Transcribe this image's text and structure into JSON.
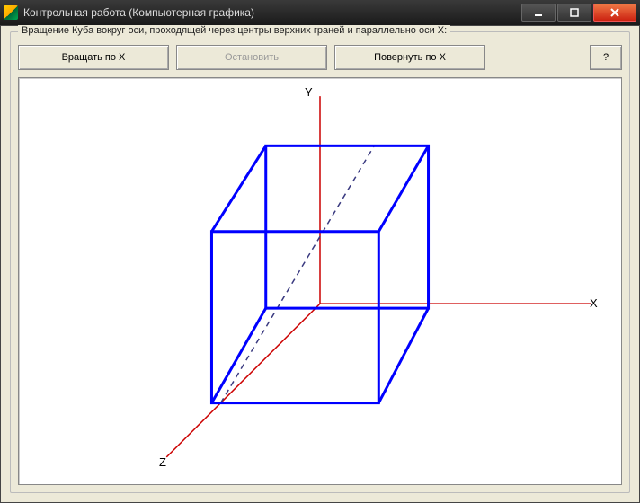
{
  "window": {
    "title": "Контрольная работа (Компьютерная графика)"
  },
  "group": {
    "legend": "Вращение Куба вокруг оси, проходящей через центры верхних граней и параллельно оси X:"
  },
  "buttons": {
    "rotate": "Вращать по X",
    "stop": "Остановить",
    "turn": "Повернуть по X",
    "help": "?"
  },
  "axes": {
    "x": "X",
    "y": "Y",
    "z": "Z"
  },
  "colors": {
    "axis": "#cc0000",
    "cube": "#0000ff",
    "dashed": "#3a3a80"
  }
}
